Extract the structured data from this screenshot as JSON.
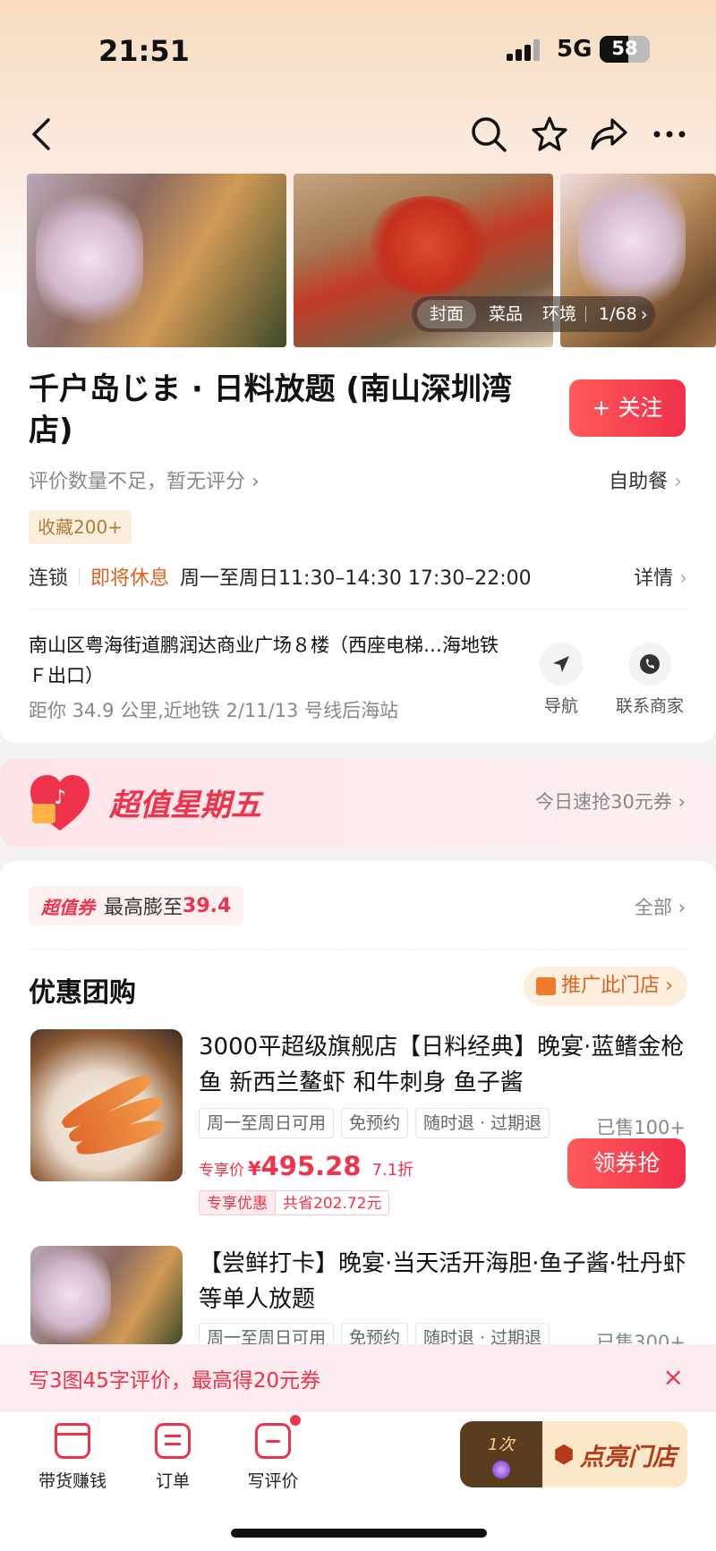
{
  "status_bar": {
    "time": "21:51",
    "network": "5G",
    "battery": "58",
    "battery_level": 0.58
  },
  "gallery": {
    "tabs": [
      "封面",
      "菜品",
      "环境"
    ],
    "count": "1/68"
  },
  "shop": {
    "name": "千户岛じま · 日料放题 (南山深圳湾店)",
    "follow_label": "+ 关注",
    "rating_text": "评价数量不足，暂无评分",
    "category": "自助餐",
    "favorites": "收藏200+",
    "chain": "连锁",
    "status": "即将休息",
    "hours": "周一至周日11:30–14:30 17:30–22:00",
    "details_label": "详情",
    "address": "南山区粤海街道鹏润达商业广场８楼（西座电梯…海地铁Ｆ出口）",
    "distance": "距你 34.9 公里,近地铁 2/11/13 号线后海站",
    "navigate_label": "导航",
    "contact_label": "联系商家"
  },
  "promo": {
    "title": "超值星期五",
    "subtitle": "今日速抢30元券"
  },
  "coupons": {
    "badge": "超值券",
    "text_prefix": "最高膨至",
    "amount": "39.4",
    "all_label": "全部"
  },
  "deals_section": {
    "title": "优惠团购",
    "promote_label": "推广此门店"
  },
  "deals": [
    {
      "title": "3000平超级旗舰店【日料经典】晚宴·蓝鳍金枪鱼 新西兰鳌虾 和牛刺身 鱼子酱",
      "tags": [
        "周一至周日可用",
        "免预约",
        "随时退 · 过期退"
      ],
      "sold": "已售100+",
      "price_label": "专享价",
      "currency": "¥",
      "price": "495.28",
      "discount": "7.1折",
      "saving_label": "专享优惠",
      "saving_text": "共省202.72元",
      "button": "领券抢"
    },
    {
      "title": "【尝鲜打卡】晚宴·当天活开海胆·鱼子酱·牡丹虾等单人放题",
      "tags": [
        "周一至周日可用",
        "免预约",
        "随时退 · 过期退"
      ],
      "sold": "已售300+"
    }
  ],
  "notice": {
    "text": "写3图45字评价，最高得20元券",
    "close": "×"
  },
  "tabbar": {
    "items": [
      "带货赚钱",
      "订单",
      "写评价"
    ],
    "light_count": "1次",
    "light_label": "点亮门店"
  },
  "colors": {
    "accent": "#f0334c",
    "orange": "#e0611e"
  }
}
